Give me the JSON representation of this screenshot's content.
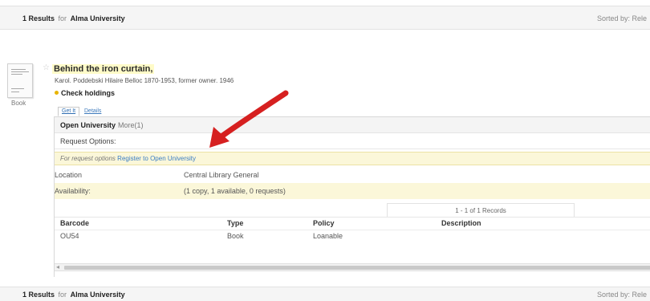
{
  "results_header": {
    "count": "1 Results",
    "for_text": "for",
    "institution": "Alma University",
    "sorted_by": "Sorted by: Rele"
  },
  "record": {
    "format_label": "Book",
    "title": "Behind the iron curtain,",
    "author": "Karol. Poddebski Hilaire Belloc 1870-1953, former owner. 1946",
    "holdings_label": "Check holdings"
  },
  "tabs": [
    {
      "label": "Get It"
    },
    {
      "label": "Details"
    }
  ],
  "get_it": {
    "institution": "Open University",
    "more": "More(1)",
    "request_options_label": "Request Options:",
    "request_prompt": "For request options",
    "register_link": "Register to Open University",
    "location_label": "Location",
    "location_value": "Central Library   General",
    "availability_label": "Availability:",
    "availability_value": "(1 copy, 1 available, 0 requests)",
    "records_label": "1 - 1 of 1 Records",
    "columns": [
      "Barcode",
      "Type",
      "Policy",
      "Description"
    ],
    "rows": [
      [
        "OU54",
        "Book",
        "Loanable",
        ""
      ]
    ]
  },
  "colors": {
    "arrow": "#d62020",
    "link": "#3a7dc4",
    "highlight": "#fbf7d9"
  }
}
